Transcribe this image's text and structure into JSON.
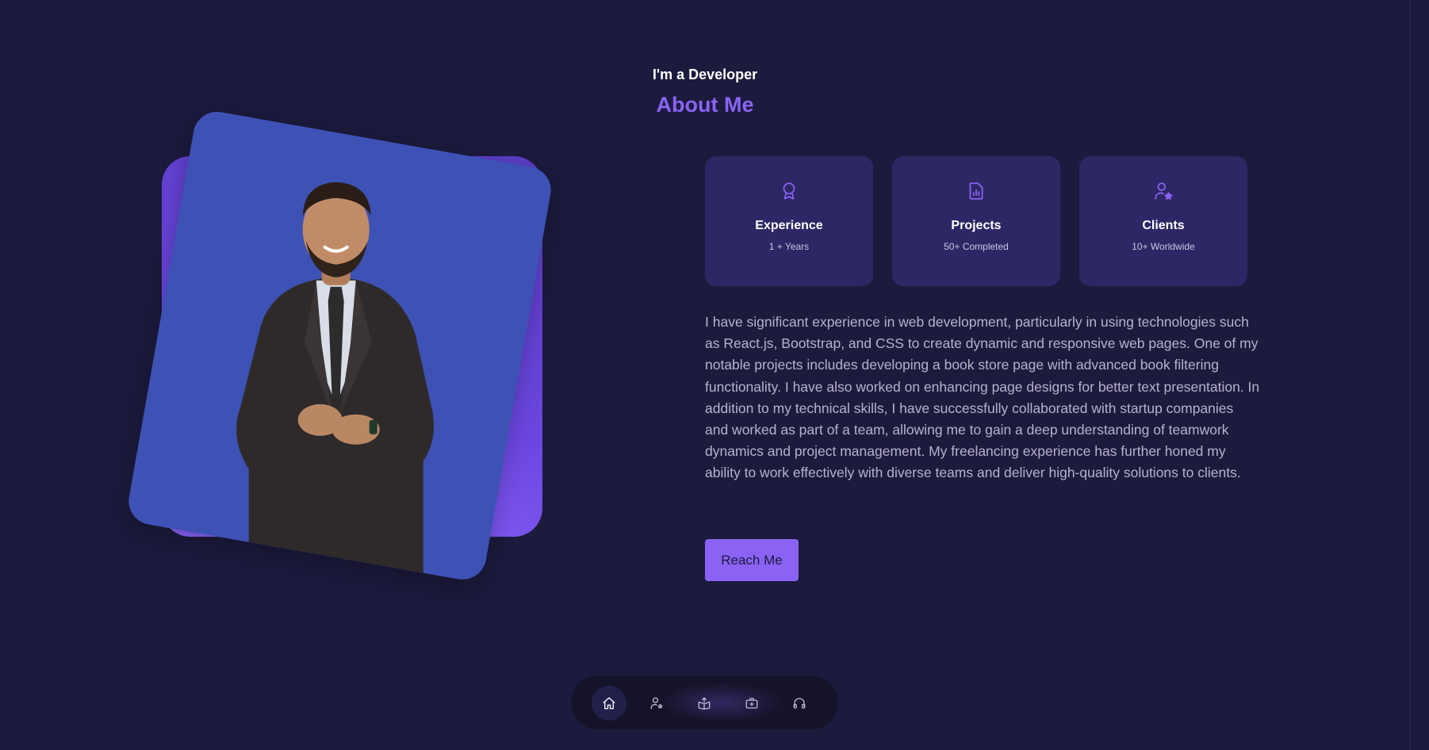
{
  "header": {
    "subtitle": "I'm a Developer",
    "title": "About Me"
  },
  "stats": [
    {
      "icon": "award-icon",
      "title": "Experience",
      "value": "1 + Years"
    },
    {
      "icon": "file-chart-icon",
      "title": "Projects",
      "value": "50+ Completed"
    },
    {
      "icon": "user-star-icon",
      "title": "Clients",
      "value": "10+ Worldwide"
    }
  ],
  "about": {
    "paragraph": "I have significant experience in web development, particularly in using technologies such as React.js, Bootstrap, and CSS to create dynamic and responsive web pages. One of my notable projects includes developing a book store page with advanced book filtering functionality. I have also worked on enhancing page designs for better text presentation. In addition to my technical skills, I have successfully collaborated with startup companies and worked as part of a team, allowing me to gain a deep understanding of teamwork dynamics and project management. My freelancing experience has further honed my ability to work effectively with diverse teams and deliver high-quality solutions to clients.",
    "button_label": "Reach Me"
  },
  "nav": {
    "items": [
      "home-icon",
      "user-icon",
      "book-icon",
      "briefcase-icon",
      "headphones-icon"
    ],
    "active_index": 0
  },
  "colors": {
    "background": "#1c1a3d",
    "accent": "#8a63f5",
    "card": "#2e2765",
    "photo_card": "#3e51b5",
    "text_muted": "#b7b3cc"
  }
}
